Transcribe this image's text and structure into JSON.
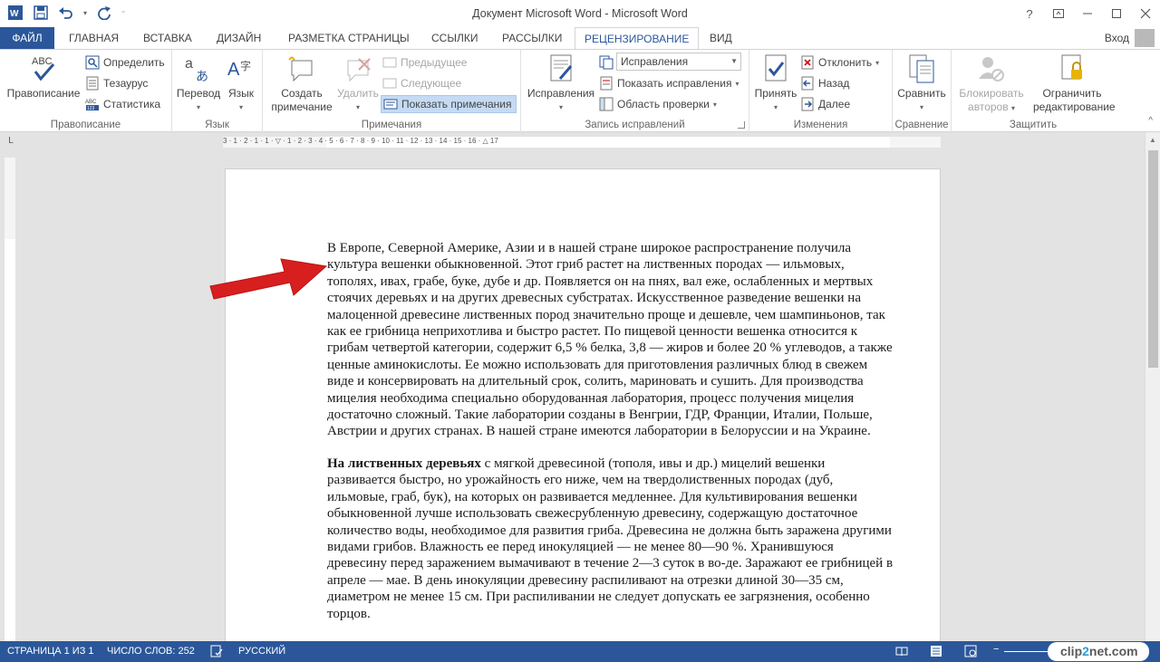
{
  "window": {
    "title": "Документ Microsoft Word - Microsoft Word",
    "help": "?",
    "signin": "Вход"
  },
  "qat": {
    "icons": [
      "word-app-icon",
      "save-icon",
      "undo-icon",
      "redo-icon",
      "customize-qat-icon"
    ]
  },
  "tabs": {
    "file": "ФАЙЛ",
    "items": [
      "ГЛАВНАЯ",
      "ВСТАВКА",
      "ДИЗАЙН",
      "РАЗМЕТКА СТРАНИЦЫ",
      "ССЫЛКИ",
      "РАССЫЛКИ",
      "РЕЦЕНЗИРОВАНИЕ",
      "ВИД"
    ],
    "active": "РЕЦЕНЗИРОВАНИЕ"
  },
  "ribbon": {
    "proofing": {
      "label": "Правописание",
      "spelling": "Правописание",
      "abc": "ABC",
      "define": "Определить",
      "thesaurus": "Тезаурус",
      "stats": "Статистика"
    },
    "language": {
      "label": "Язык",
      "translate": "Перевод",
      "lang": "Язык"
    },
    "comments": {
      "label": "Примечания",
      "new_1": "Создать",
      "new_2": "примечание",
      "delete": "Удалить",
      "prev": "Предыдущее",
      "next": "Следующее",
      "show": "Показать примечания"
    },
    "tracking": {
      "label": "Запись исправлений",
      "track": "Исправления",
      "display": "Исправления",
      "show_markup": "Показать исправления",
      "pane": "Область проверки"
    },
    "changes": {
      "label": "Изменения",
      "accept": "Принять",
      "reject": "Отклонить",
      "back": "Назад",
      "next": "Далее"
    },
    "compare": {
      "label": "Сравнение",
      "compare": "Сравнить"
    },
    "protect": {
      "label": "Защитить",
      "block_1": "Блокировать",
      "block_2": "авторов",
      "restrict_1": "Ограничить",
      "restrict_2": "редактирование"
    }
  },
  "ruler": {
    "ticks": "3 · 1 · 2 · 1 · 1 · ▽ · 1 · 2 · 3 · 4 · 5 · 6 · 7 · 8 · 9 · 10 · 11 · 12 · 13 · 14 · 15 · 16 · △ 17",
    "corner": "L"
  },
  "document": {
    "paragraph1": "В Европе, Северной Америке, Азии и в нашей стране широкое распространение получила культура вешенки обыкновенной. Этот гриб растет на лиственных породах — ильмовых, тополях, ивах, грабе, буке, дубе и др. Появляется он на пнях, вал еже, ослабленных и мертвых стоячих деревьях и на других древесных субстратах. Искусственное разведение вешенки на малоценной древесине лиственных пород значительно проще и дешевле, чем шампиньонов, так как ее грибница неприхотлива и быстро растет. По пищевой ценности вешенка относится к грибам четвертой категории, содержит 6,5 % белка, 3,8 — жиров и более 20 % углеводов, а также ценные аминокислоты. Ее можно использовать для приготовления различных блюд в свежем виде и консервировать на длительный срок, солить, мариновать и сушить. Для производства мицелия необходима специально оборудованная лаборатория, процесс получения мицелия достаточно сложный. Такие лаборатории созданы в Венгрии, ГДР, Франции, Италии, Польше, Австрии и других странах. В нашей стране имеются лаборатории в Белоруссии и на Украине.",
    "paragraph2_bold": "На лиственных деревьях",
    "paragraph2": " с мягкой древесиной (тополя, ивы и др.) мицелий вешенки развивается быстро, но урожайность его ниже, чем на твердолиственных породах (дуб, ильмовые, граб, бук), на которых он развивается медленнее. Для культивирования вешенки обыкновенной лучше использовать свежесрубленную древесину, содержащую достаточное количество воды, необходимое для развития гриба. Древесина не должна быть заражена другими видами грибов. Влажность ее перед инокуляцией — не менее 80—90 %. Хранившуюся древесину перед заражением вымачивают в течение 2—3 суток в во-де. Заражают ее грибницей в апреле — мае. В день инокуляции древесину распиливают на отрезки длиной 30—35 см, диаметром не менее 15 см. При распиливании не следует допускать ее загрязнения, особенно торцов."
  },
  "status": {
    "page": "СТРАНИЦА 1 ИЗ 1",
    "words": "ЧИСЛО СЛОВ: 252",
    "language": "РУССКИЙ"
  },
  "watermark": {
    "part1": "clip",
    "part2": "2",
    "part3": "net.com"
  },
  "colors": {
    "accent": "#2b579a",
    "arrow": "#d71f1f"
  }
}
